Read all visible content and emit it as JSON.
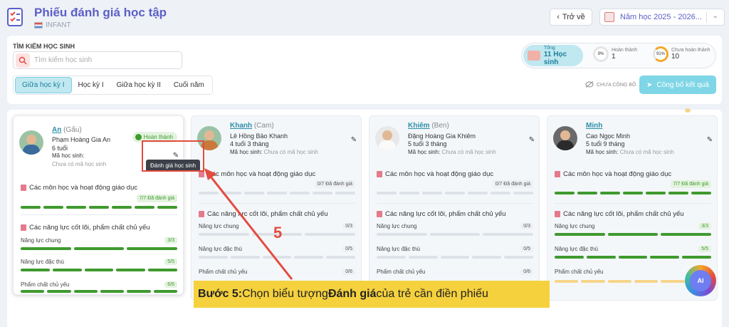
{
  "header": {
    "title": "Phiếu đánh giá học tập",
    "subtitle": "INFANT",
    "back_label": "Trở về",
    "school_year": "Năm học 2025 - 2026..."
  },
  "search": {
    "label": "TÌM KIẾM HỌC SINH",
    "placeholder": "Tìm kiếm học sinh"
  },
  "tabs": [
    {
      "label": "Giữa học kỳ I",
      "active": true
    },
    {
      "label": "Học kỳ I",
      "active": false
    },
    {
      "label": "Giữa học kỳ II",
      "active": false
    },
    {
      "label": "Cuối năm",
      "active": false
    }
  ],
  "stats": {
    "total_label": "Tổng",
    "total_value": "11 Học sinh",
    "done_percent": "9%",
    "done_label": "Hoàn thành",
    "done_value": "1",
    "pending_percent": "91%",
    "pending_label": "Chưa hoàn thành",
    "pending_value": "10"
  },
  "publish": {
    "status": "CHƯA CÔNG BỐ",
    "button": "Công bố kết quả"
  },
  "sections": {
    "subjects": "Các môn học và hoạt động giáo dục",
    "competencies": "Các năng lực cốt lõi, phẩm chất chủ yếu",
    "general": "Năng lực chung",
    "specific": "Năng lực đặc thù",
    "qualities": "Phẩm chất chủ yếu",
    "code_label": "Mã học sinh:",
    "no_code": "Chưa có mã học sinh"
  },
  "students": [
    {
      "nickname": "An",
      "alias": "(Gấu)",
      "fullname": "Phạm Hoàng Gia An",
      "age": "6 tuổi",
      "status": "Hoàn thành",
      "subjects_count": "7/7 Đã đánh giá",
      "general_count": "3/3",
      "specific_count": "5/5",
      "qualities_count": "6/6"
    },
    {
      "nickname": "Khanh",
      "alias": "(Cam)",
      "fullname": "Lê Hồng Bảo Khanh",
      "age": "4 tuổi 3 tháng",
      "subjects_count": "0/7 Đã đánh giá",
      "general_count": "0/3",
      "specific_count": "0/5",
      "qualities_count": "0/6"
    },
    {
      "nickname": "Khiêm",
      "alias": "(Ben)",
      "fullname": "Đặng Hoàng Gia Khiêm",
      "age": "5 tuổi 3 tháng",
      "subjects_count": "0/7 Đã đánh giá",
      "general_count": "0/3",
      "specific_count": "0/5",
      "qualities_count": "0/6"
    },
    {
      "nickname": "Minh",
      "alias": "",
      "fullname": "Cao Ngọc Minh",
      "age": "5 tuổi 9 tháng",
      "subjects_count": "7/7 Đã đánh giá",
      "general_count": "3/3",
      "specific_count": "5/5",
      "qualities_count": ""
    }
  ],
  "tooltip": "Đánh giá học sinh",
  "annotation": {
    "step_number": "5",
    "caption_prefix": "Bước 5:",
    "caption_mid": " Chọn biểu tượng ",
    "caption_bold": "Đánh giá",
    "caption_suffix": " của trẻ cần điền phiếu"
  },
  "ai_label": "AI"
}
